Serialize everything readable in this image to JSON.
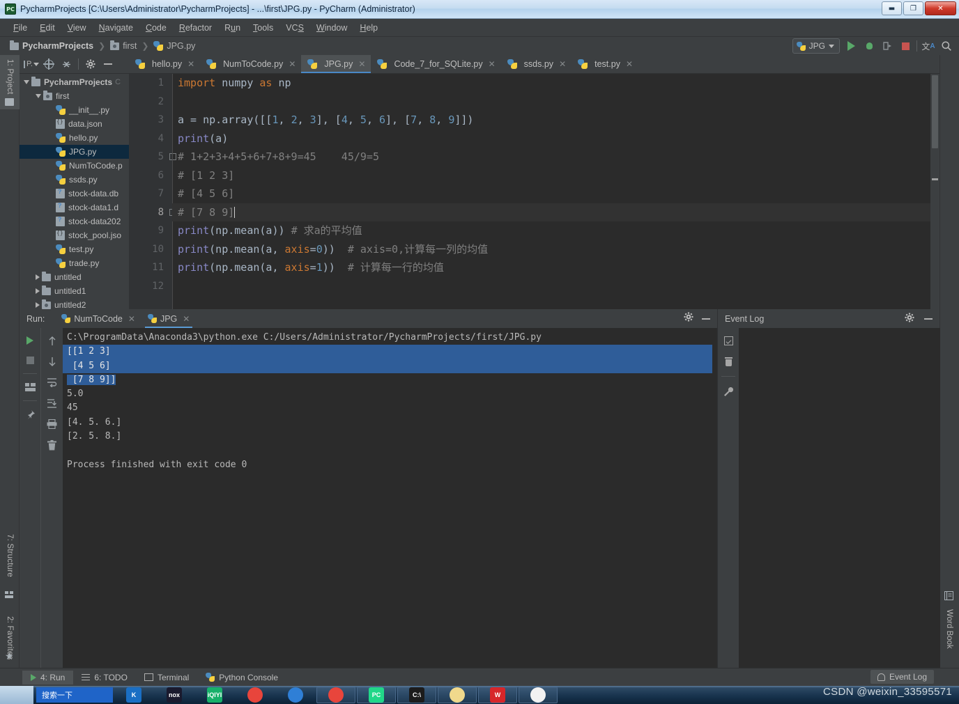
{
  "window": {
    "title": "PycharmProjects [C:\\Users\\Administrator\\PycharmProjects] - ...\\first\\JPG.py - PyCharm (Administrator)",
    "app_badge": "PC",
    "minimize_label": "—",
    "maximize_label": "❐",
    "close_label": "✕"
  },
  "menubar": {
    "items": [
      {
        "label": "File",
        "accel": "F"
      },
      {
        "label": "Edit",
        "accel": "E"
      },
      {
        "label": "View",
        "accel": "V"
      },
      {
        "label": "Navigate",
        "accel": "N"
      },
      {
        "label": "Code",
        "accel": "C"
      },
      {
        "label": "Refactor",
        "accel": "R"
      },
      {
        "label": "Run",
        "accel": "u"
      },
      {
        "label": "Tools",
        "accel": "T"
      },
      {
        "label": "VCS",
        "accel": "S"
      },
      {
        "label": "Window",
        "accel": "W"
      },
      {
        "label": "Help",
        "accel": "H"
      }
    ]
  },
  "breadcrumb": {
    "items": [
      "PycharmProjects",
      "first",
      "JPG.py"
    ],
    "separator": "❯"
  },
  "toolbar_right": {
    "run_config": "JPG",
    "icons": [
      "run-icon",
      "debug-icon",
      "coverage-icon",
      "stop-icon",
      "translate-icon",
      "search-icon"
    ]
  },
  "left_tabs": [
    {
      "label": "1: Project",
      "accel": "1",
      "active": true
    },
    {
      "label": "7: Structure",
      "accel": "7",
      "active": false
    },
    {
      "label": "2: Favorites",
      "accel": "2",
      "active": false
    }
  ],
  "right_tabs": [
    {
      "label": "Word Book"
    }
  ],
  "project_panel": {
    "toolbar_icons": [
      "project-view-icon",
      "locate-icon",
      "collapse-all-icon",
      "settings-icon",
      "hide-icon"
    ],
    "tree": [
      {
        "label": "PycharmProjects",
        "depth": 0,
        "arrow": "down",
        "icon": "folder",
        "bold": true,
        "badge": "C",
        "selected": false
      },
      {
        "label": "first",
        "depth": 1,
        "arrow": "down",
        "icon": "folder-src",
        "selected": false
      },
      {
        "label": "__init__.py",
        "depth": 2,
        "arrow": "none",
        "icon": "python",
        "selected": false
      },
      {
        "label": "data.json",
        "depth": 2,
        "arrow": "none",
        "icon": "json",
        "selected": false
      },
      {
        "label": "hello.py",
        "depth": 2,
        "arrow": "none",
        "icon": "python",
        "selected": false
      },
      {
        "label": "JPG.py",
        "depth": 2,
        "arrow": "none",
        "icon": "python",
        "selected": true
      },
      {
        "label": "NumToCode.p",
        "depth": 2,
        "arrow": "none",
        "icon": "python",
        "selected": false
      },
      {
        "label": "ssds.py",
        "depth": 2,
        "arrow": "none",
        "icon": "python",
        "selected": false
      },
      {
        "label": "stock-data.db",
        "depth": 2,
        "arrow": "none",
        "icon": "db",
        "selected": false
      },
      {
        "label": "stock-data1.d",
        "depth": 2,
        "arrow": "none",
        "icon": "db",
        "selected": false
      },
      {
        "label": "stock-data202",
        "depth": 2,
        "arrow": "none",
        "icon": "db",
        "selected": false
      },
      {
        "label": "stock_pool.jso",
        "depth": 2,
        "arrow": "none",
        "icon": "json",
        "selected": false
      },
      {
        "label": "test.py",
        "depth": 2,
        "arrow": "none",
        "icon": "python",
        "selected": false
      },
      {
        "label": "trade.py",
        "depth": 2,
        "arrow": "none",
        "icon": "python",
        "selected": false
      },
      {
        "label": "untitled",
        "depth": 1,
        "arrow": "right",
        "icon": "folder",
        "selected": false
      },
      {
        "label": "untitled1",
        "depth": 1,
        "arrow": "right",
        "icon": "folder",
        "selected": false
      },
      {
        "label": "untitled2",
        "depth": 1,
        "arrow": "right",
        "icon": "folder-src",
        "selected": false
      }
    ]
  },
  "editor": {
    "tabs": [
      {
        "label": "hello.py",
        "active": false
      },
      {
        "label": "NumToCode.py",
        "active": false
      },
      {
        "label": "JPG.py",
        "active": true
      },
      {
        "label": "Code_7_for_SQLite.py",
        "active": false
      },
      {
        "label": "ssds.py",
        "active": false
      },
      {
        "label": "test.py",
        "active": false
      }
    ],
    "close_glyph": "✕",
    "line_numbers": [
      "1",
      "2",
      "3",
      "4",
      "5",
      "6",
      "7",
      "8",
      "9",
      "10",
      "11",
      "12"
    ],
    "current_line": 8,
    "lines": [
      {
        "n": 1,
        "tokens": [
          {
            "t": "import",
            "c": "kw"
          },
          {
            "t": " numpy ",
            "c": "vtxt"
          },
          {
            "t": "as",
            "c": "kw"
          },
          {
            "t": " np",
            "c": "vtxt"
          }
        ]
      },
      {
        "n": 2,
        "tokens": []
      },
      {
        "n": 3,
        "tokens": [
          {
            "t": "a = np.array([[",
            "c": "vtxt"
          },
          {
            "t": "1",
            "c": "num"
          },
          {
            "t": ", ",
            "c": "vtxt"
          },
          {
            "t": "2",
            "c": "num"
          },
          {
            "t": ", ",
            "c": "vtxt"
          },
          {
            "t": "3",
            "c": "num"
          },
          {
            "t": "], [",
            "c": "vtxt"
          },
          {
            "t": "4",
            "c": "num"
          },
          {
            "t": ", ",
            "c": "vtxt"
          },
          {
            "t": "5",
            "c": "num"
          },
          {
            "t": ", ",
            "c": "vtxt"
          },
          {
            "t": "6",
            "c": "num"
          },
          {
            "t": "], [",
            "c": "vtxt"
          },
          {
            "t": "7",
            "c": "num"
          },
          {
            "t": ", ",
            "c": "vtxt"
          },
          {
            "t": "8",
            "c": "num"
          },
          {
            "t": ", ",
            "c": "vtxt"
          },
          {
            "t": "9",
            "c": "num"
          },
          {
            "t": "]])",
            "c": "vtxt"
          }
        ]
      },
      {
        "n": 4,
        "tokens": [
          {
            "t": "print",
            "c": "fn"
          },
          {
            "t": "(a)",
            "c": "vtxt"
          }
        ]
      },
      {
        "n": 5,
        "tokens": [
          {
            "t": "# 1+2+3+4+5+6+7+8+9=45    45/9=5",
            "c": "cm"
          }
        ],
        "fold": true
      },
      {
        "n": 6,
        "tokens": [
          {
            "t": "# [1 2 3]",
            "c": "cm"
          }
        ]
      },
      {
        "n": 7,
        "tokens": [
          {
            "t": "# [4 5 6]",
            "c": "cm"
          }
        ]
      },
      {
        "n": 8,
        "tokens": [
          {
            "t": "# [7 8 9]",
            "c": "cm"
          }
        ],
        "fold": true,
        "caret": true
      },
      {
        "n": 9,
        "tokens": [
          {
            "t": "print",
            "c": "fn"
          },
          {
            "t": "(np.mean(a)) ",
            "c": "vtxt"
          },
          {
            "t": "# 求a的平均值",
            "c": "cm"
          }
        ]
      },
      {
        "n": 10,
        "tokens": [
          {
            "t": "print",
            "c": "fn"
          },
          {
            "t": "(np.mean(a, ",
            "c": "vtxt"
          },
          {
            "t": "axis",
            "c": "kw"
          },
          {
            "t": "=",
            "c": "vtxt"
          },
          {
            "t": "0",
            "c": "num"
          },
          {
            "t": "))  ",
            "c": "vtxt"
          },
          {
            "t": "# axis=0,计算每一列的均值",
            "c": "cm"
          }
        ]
      },
      {
        "n": 11,
        "tokens": [
          {
            "t": "print",
            "c": "fn"
          },
          {
            "t": "(np.mean(a, ",
            "c": "vtxt"
          },
          {
            "t": "axis",
            "c": "kw"
          },
          {
            "t": "=",
            "c": "vtxt"
          },
          {
            "t": "1",
            "c": "num"
          },
          {
            "t": "))  ",
            "c": "vtxt"
          },
          {
            "t": "# 计算每一行的均值",
            "c": "cm"
          }
        ]
      },
      {
        "n": 12,
        "tokens": []
      }
    ]
  },
  "run_panel": {
    "label": "Run:",
    "tabs": [
      {
        "label": "NumToCode",
        "active": false
      },
      {
        "label": "JPG",
        "active": true
      }
    ],
    "close_glyph": "✕",
    "sidebar_icons": [
      "rerun-icon",
      "stop-icon",
      "layout-icon",
      "pin-icon"
    ],
    "sidebar_icons2": [
      "up-arrow-icon",
      "down-arrow-icon",
      "soft-wrap-icon",
      "scroll-to-end-icon",
      "print-icon",
      "clear-all-icon"
    ],
    "header_icons": [
      "settings-icon",
      "hide-icon"
    ],
    "console": [
      {
        "text": "C:\\ProgramData\\Anaconda3\\python.exe C:/Users/Administrator/PycharmProjects/first/JPG.py",
        "highlight": false
      },
      {
        "text": "[[1 2 3]",
        "highlight": true,
        "full_row": true
      },
      {
        "text": " [4 5 6]",
        "highlight": true,
        "full_row": true
      },
      {
        "text": " [7 8 9]]",
        "highlight": true,
        "full_row": false
      },
      {
        "text": "5.0",
        "highlight": false
      },
      {
        "text": "45",
        "highlight": false
      },
      {
        "text": "[4. 5. 6.]",
        "highlight": false
      },
      {
        "text": "[2. 5. 8.]",
        "highlight": false
      },
      {
        "text": "",
        "highlight": false
      },
      {
        "text": "Process finished with exit code 0",
        "highlight": false
      }
    ]
  },
  "event_log": {
    "title": "Event Log",
    "header_icons": [
      "settings-icon",
      "hide-icon"
    ],
    "sidebar_icons": [
      "mark-read-icon",
      "delete-icon",
      "configure-icon"
    ]
  },
  "status_bar": {
    "items": [
      {
        "label": "4: Run",
        "accel": "4",
        "icon": "run-icon",
        "active": true
      },
      {
        "label": "6: TODO",
        "accel": "6",
        "icon": "todo-icon",
        "active": false
      },
      {
        "label": "Terminal",
        "accel": "",
        "icon": "terminal-icon",
        "active": false
      },
      {
        "label": "Python Console",
        "accel": "",
        "icon": "python-console-icon",
        "active": false
      }
    ],
    "right": {
      "label": "Event Log",
      "icon": "bell-icon"
    }
  },
  "taskbar": {
    "search_text": "搜索一下",
    "apps": [
      {
        "name": "kingsoft",
        "glyph": "K",
        "color": "#1a6fc4",
        "boxed": false
      },
      {
        "name": "nox",
        "glyph": "nox",
        "color": "#1a1a2e",
        "boxed": false
      },
      {
        "name": "iqiyi",
        "glyph": "iQIYI",
        "color": "#18b06a",
        "boxed": false
      },
      {
        "name": "chrome",
        "glyph": "",
        "color": "#e8453c",
        "boxed": false
      },
      {
        "name": "browser",
        "glyph": "",
        "color": "#2f7fd6",
        "boxed": false
      },
      {
        "name": "chrome-window",
        "glyph": "",
        "color": "#e8453c",
        "boxed": true
      },
      {
        "name": "pycharm-window",
        "glyph": "PC",
        "color": "#21d789",
        "boxed": true
      },
      {
        "name": "cmd-window",
        "glyph": "C:\\",
        "color": "#1c1c1c",
        "boxed": true
      },
      {
        "name": "notes-window",
        "glyph": "",
        "color": "#f0d98c",
        "boxed": true
      },
      {
        "name": "wps-window",
        "glyph": "W",
        "color": "#d7262a",
        "boxed": true
      },
      {
        "name": "file-window",
        "glyph": "",
        "color": "#f2f2f2",
        "boxed": true
      }
    ]
  },
  "watermark": "CSDN @weixin_33595571"
}
